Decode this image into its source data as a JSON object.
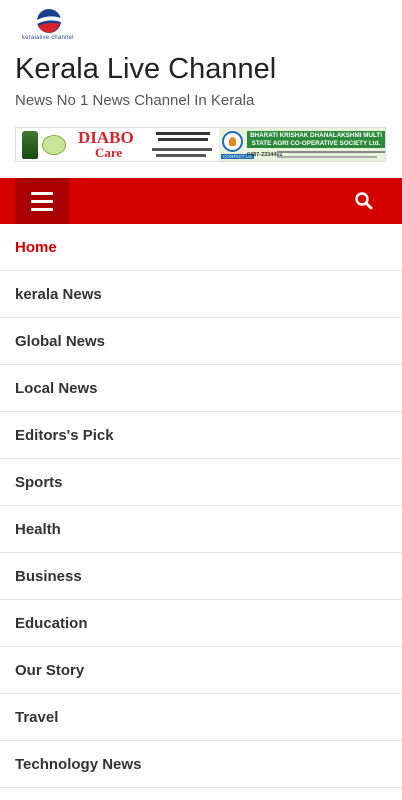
{
  "header": {
    "logo_subtext": "keralalive channel",
    "site_title": "Kerala Live Channel",
    "tagline": "News No 1 News Channel In Kerala"
  },
  "ad": {
    "left_brand": "DIABO",
    "left_brand_sub": "Care",
    "right_headline": "BHARATI KRISHAK DHANALAKSHMI MULTI STATE AGRI CO-OPERATIVE SOCIETY Ltd.",
    "contact_label": "CONTACT US",
    "phone": "0487-2334451"
  },
  "navbar": {
    "menu_icon": "hamburger-icon",
    "search_icon": "search-icon",
    "bg_color": "#d40000"
  },
  "menu": {
    "active_color": "#d40000",
    "items": [
      {
        "label": "Home"
      },
      {
        "label": "kerala News"
      },
      {
        "label": "Global News"
      },
      {
        "label": "Local News"
      },
      {
        "label": "Editors's Pick"
      },
      {
        "label": "Sports"
      },
      {
        "label": "Health"
      },
      {
        "label": "Business"
      },
      {
        "label": "Education"
      },
      {
        "label": "Our Story"
      },
      {
        "label": "Travel"
      },
      {
        "label": "Technology News"
      }
    ]
  }
}
